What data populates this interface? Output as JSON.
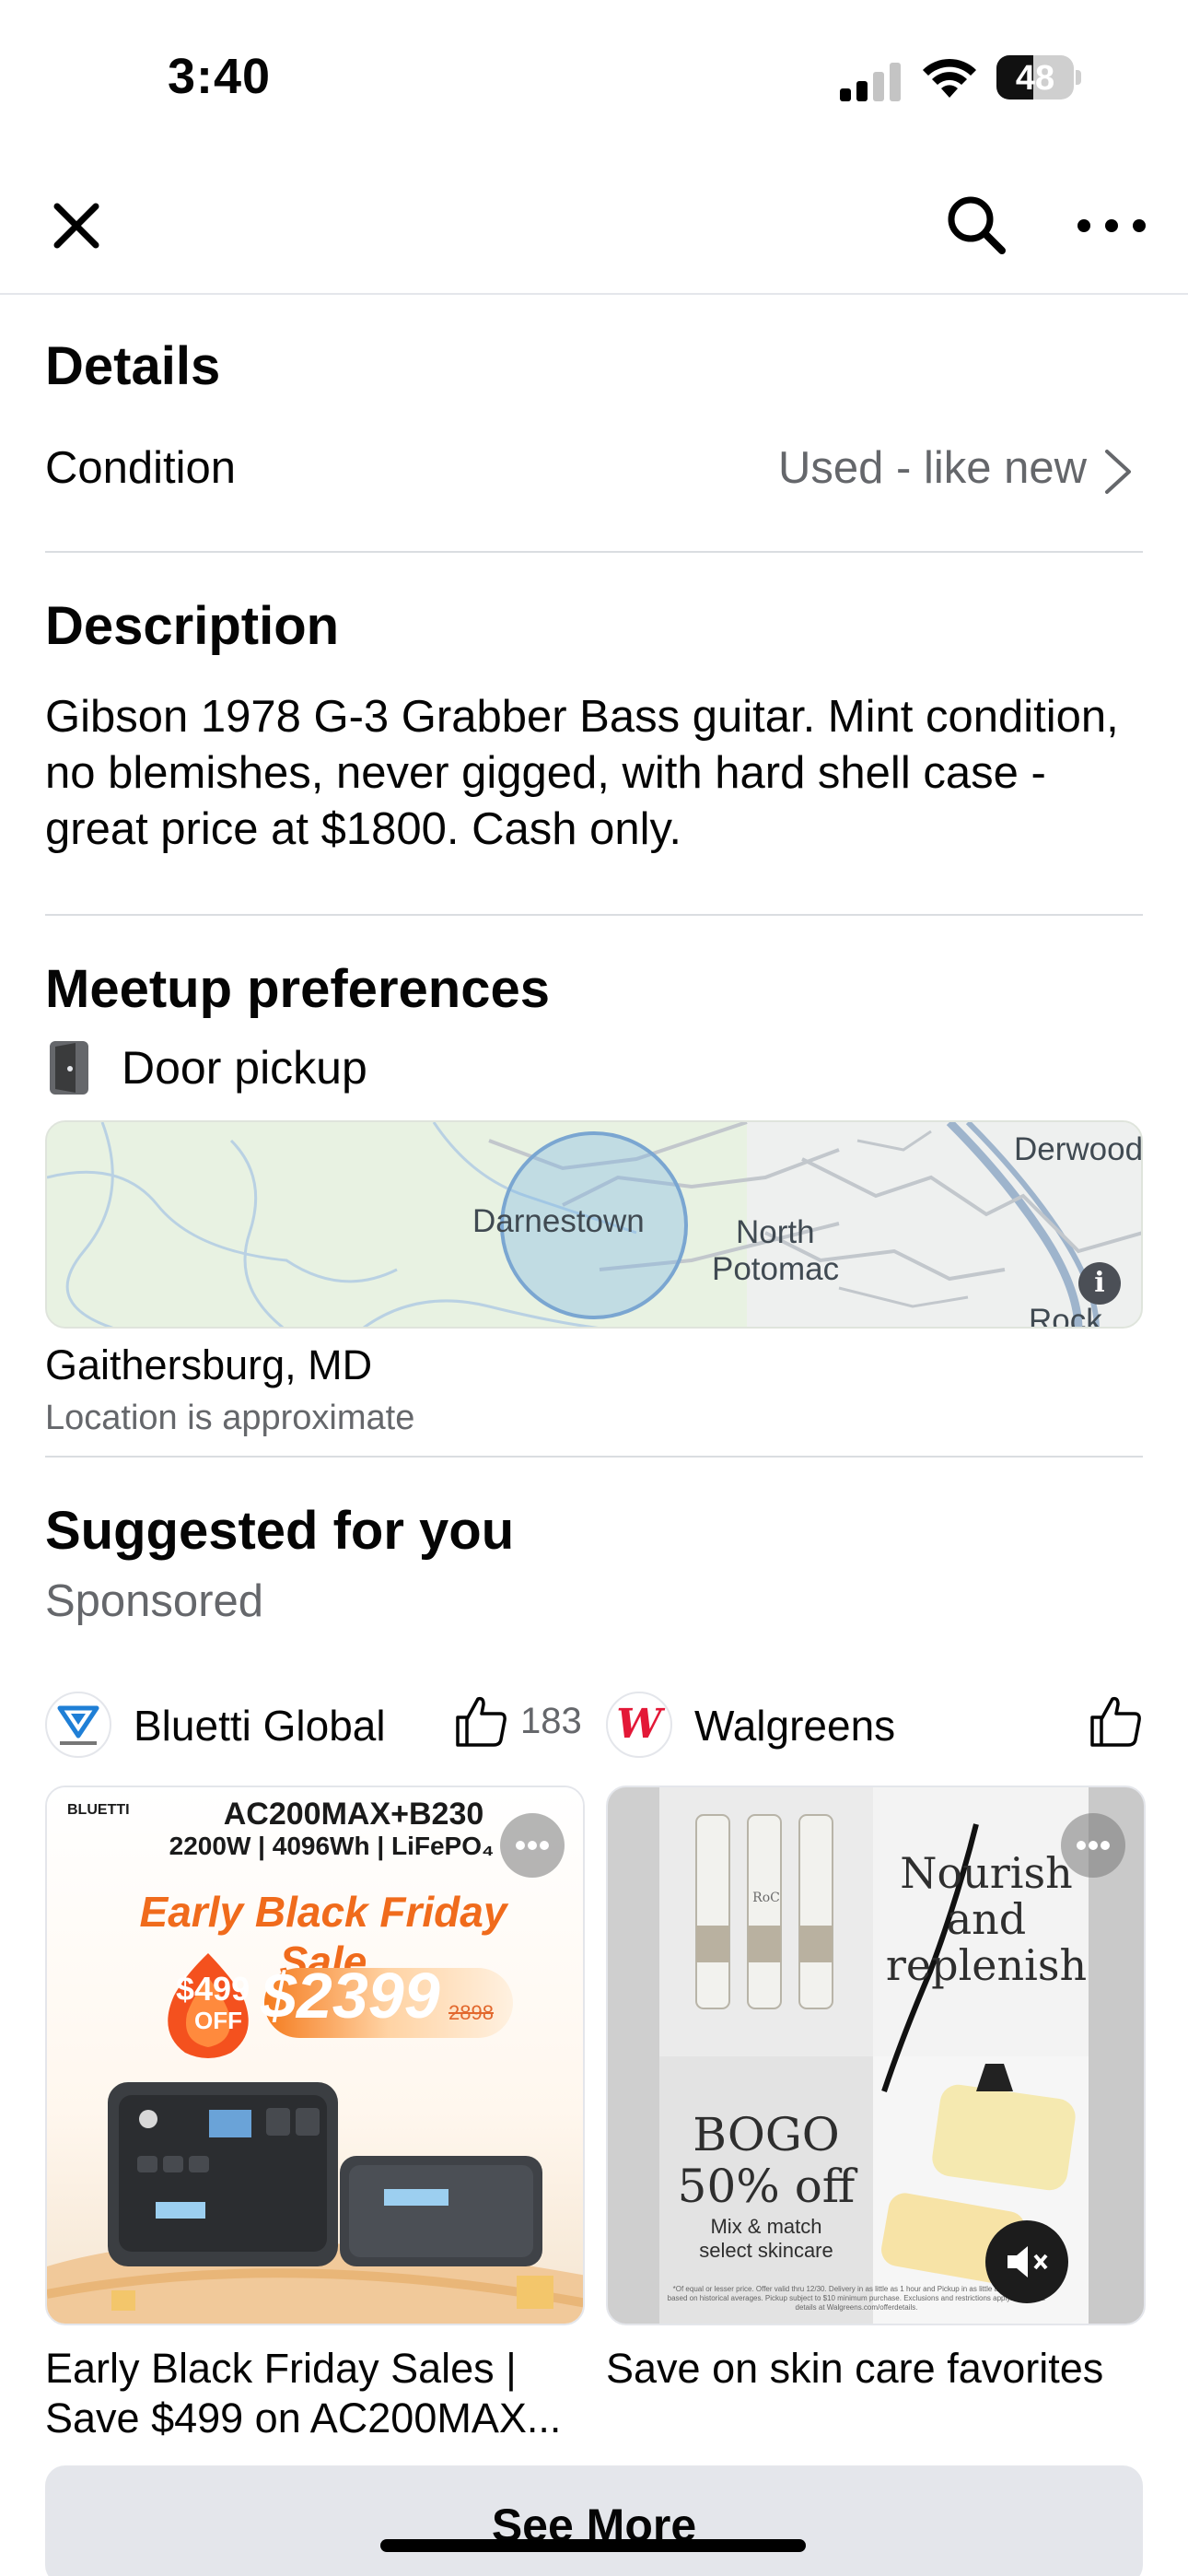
{
  "status_bar": {
    "time": "3:40",
    "battery": "48",
    "battery_level_percent": 48
  },
  "nav": {
    "close_icon": "close-icon",
    "search_icon": "search-icon",
    "more_icon": "more-horizontal-icon"
  },
  "details": {
    "title": "Details",
    "condition_label": "Condition",
    "condition_value": "Used - like new"
  },
  "description": {
    "title": "Description",
    "text": "Gibson 1978 G-3 Grabber Bass guitar. Mint condition, no blemishes, never gigged, with hard shell case - great price at $1800.  Cash only."
  },
  "meetup": {
    "title": "Meetup preferences",
    "option": "Door pickup",
    "map_labels": {
      "town1": "Darnestown",
      "town2_line1": "North",
      "town2_line2": "Potomac",
      "town3": "Derwood",
      "town4": "Rock"
    },
    "location": "Gaithersburg, MD",
    "location_note": "Location is approximate"
  },
  "suggested": {
    "title": "Suggested for you",
    "sponsored": "Sponsored",
    "ads": [
      {
        "advertiser": "Bluetti Global",
        "likes": "183",
        "title_line1": "Early Black Friday Sales |",
        "title_line2": "Save $499 on AC200MAX...",
        "creative": {
          "brand": "BLUETTI",
          "headline": "AC200MAX+B230",
          "specs": "2200W | 4096Wh | LiFePO₄",
          "sale": "Early Black Friday Sale",
          "off_amount": "$499",
          "off_label": "OFF",
          "price": "$2399",
          "old_price": "2898",
          "unit_badge": "BLUETTI"
        }
      },
      {
        "advertiser": "Walgreens",
        "likes": "",
        "title_line1": "Save on skin care favorites",
        "creative": {
          "headline_line1": "Nourish",
          "headline_line2": "and",
          "headline_line3": "replenish",
          "bogo": "BOGO",
          "offer": "50% off",
          "mix_line1": "Mix & match",
          "mix_line2": "select skincare",
          "product_label": "RoC",
          "fine_print": "*Of equal or lesser price. Offer valid thru 12/30. Delivery in as little as 1 hour and Pickup in as little as 30 minutes based on historical averages. Pickup subject to $10 minimum purchase. Exclusions and restrictions apply. Complete details at Walgreens.com/offerdetails."
        }
      }
    ],
    "see_more": "See More"
  },
  "colors": {
    "text_primary": "#050505",
    "text_secondary": "#65676b",
    "divider": "#dadde1",
    "button_bg": "#e4e6eb",
    "walgreens_red": "#e31837",
    "bluetti_orange": "#f06b1c"
  }
}
